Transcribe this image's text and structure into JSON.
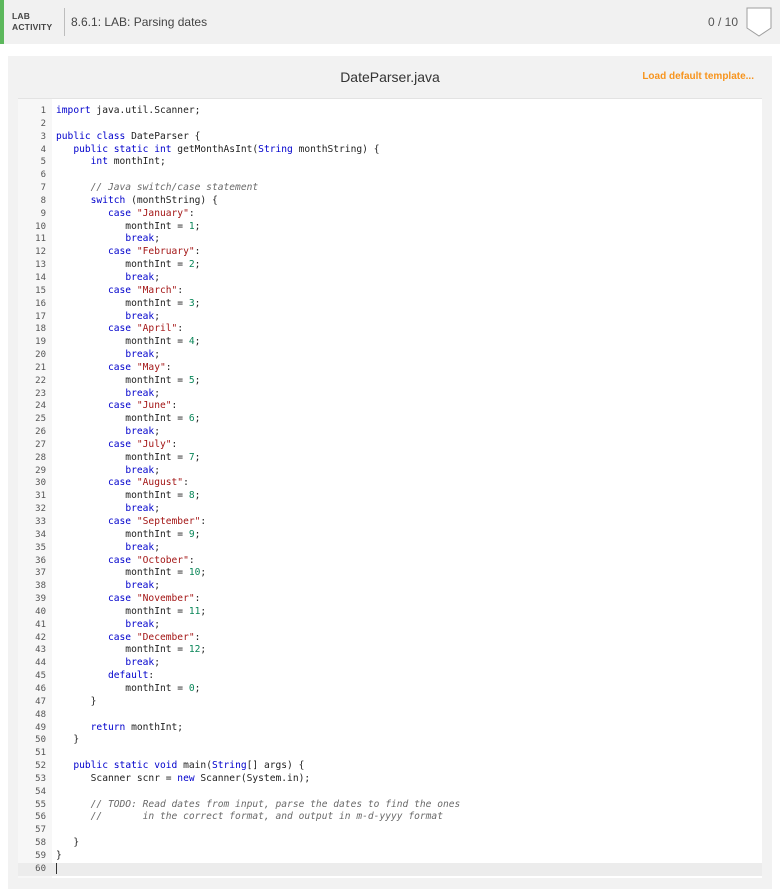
{
  "header": {
    "tag_line1": "LAB",
    "tag_line2": "ACTIVITY",
    "title": "8.6.1: LAB: Parsing dates",
    "score": "0 / 10",
    "accent_color": "#5cb85c"
  },
  "editor": {
    "file_name": "DateParser.java",
    "load_template_label": "Load default template...",
    "active_line": 60,
    "code_lines": [
      "import java.util.Scanner;",
      "",
      "public class DateParser {",
      "   public static int getMonthAsInt(String monthString) {",
      "      int monthInt;",
      "",
      "      // Java switch/case statement",
      "      switch (monthString) {",
      "         case \"January\":",
      "            monthInt = 1;",
      "            break;",
      "         case \"February\":",
      "            monthInt = 2;",
      "            break;",
      "         case \"March\":",
      "            monthInt = 3;",
      "            break;",
      "         case \"April\":",
      "            monthInt = 4;",
      "            break;",
      "         case \"May\":",
      "            monthInt = 5;",
      "            break;",
      "         case \"June\":",
      "            monthInt = 6;",
      "            break;",
      "         case \"July\":",
      "            monthInt = 7;",
      "            break;",
      "         case \"August\":",
      "            monthInt = 8;",
      "            break;",
      "         case \"September\":",
      "            monthInt = 9;",
      "            break;",
      "         case \"October\":",
      "            monthInt = 10;",
      "            break;",
      "         case \"November\":",
      "            monthInt = 11;",
      "            break;",
      "         case \"December\":",
      "            monthInt = 12;",
      "            break;",
      "         default:",
      "            monthInt = 0;",
      "      }",
      "",
      "      return monthInt;",
      "   }",
      "",
      "   public static void main(String[] args) {",
      "      Scanner scnr = new Scanner(System.in);",
      "",
      "      // TODO: Read dates from input, parse the dates to find the ones",
      "      //       in the correct format, and output in m-d-yyyy format",
      "",
      "   }",
      "}",
      ""
    ]
  }
}
